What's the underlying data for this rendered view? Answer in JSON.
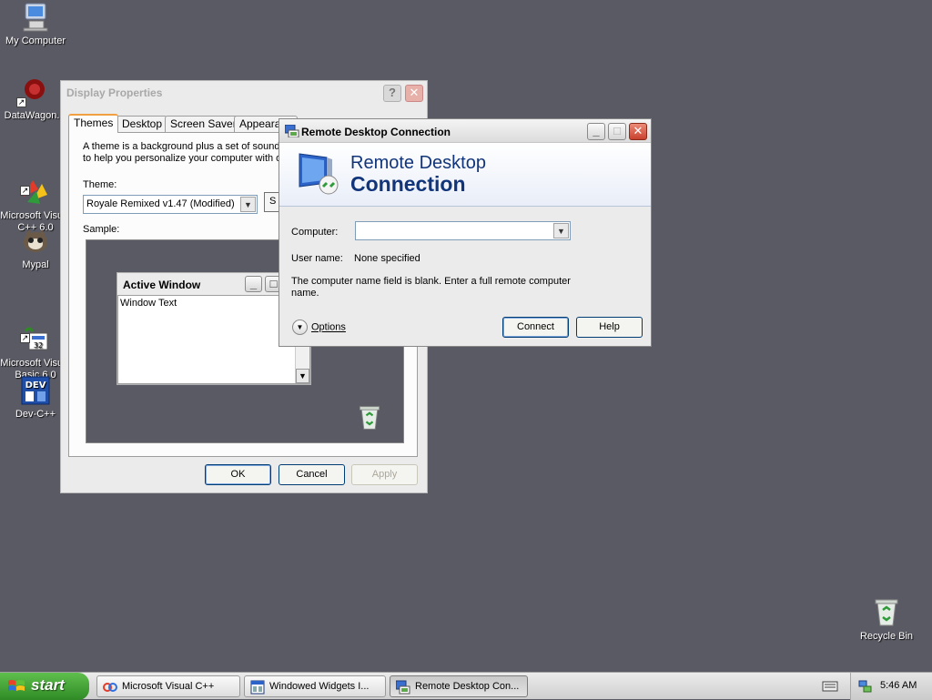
{
  "desktop": {
    "icons": [
      {
        "label": "My Computer",
        "icon": "my-computer-icon"
      },
      {
        "label": "DataWagon.",
        "icon": "datawagon-icon"
      },
      {
        "label": "Microsoft Visual\nC++ 6.0",
        "icon": "visual-cpp-icon"
      },
      {
        "label": "Mypal",
        "icon": "mypal-icon"
      },
      {
        "label": "Microsoft Visual\nBasic 6.0",
        "icon": "visual-basic-icon"
      },
      {
        "label": "Dev-C++",
        "icon": "dev-cpp-icon"
      },
      {
        "label": "Recycle Bin",
        "icon": "recycle-bin-icon"
      }
    ],
    "background_color": "#5a5a64"
  },
  "display_properties": {
    "title": "Display Properties",
    "tabs": [
      "Themes",
      "Desktop",
      "Screen Saver",
      "Appearance"
    ],
    "active_tab": "Themes",
    "description": "A theme is a background plus a set of sounds,\nto help you personalize your computer with one",
    "theme_label": "Theme:",
    "theme_value": "Royale Remixed v1.47 (Modified)",
    "save_button_partial": "S",
    "sample_label": "Sample:",
    "sample_window_title": "Active Window",
    "sample_window_text": "Window Text",
    "buttons": {
      "ok": "OK",
      "cancel": "Cancel",
      "apply": "Apply"
    }
  },
  "remote_desktop": {
    "title": "Remote Desktop Connection",
    "banner_line1": "Remote Desktop",
    "banner_line2": "Connection",
    "computer_label": "Computer:",
    "computer_value": "",
    "username_label": "User name:",
    "username_value": "None specified",
    "note": "The computer name field is blank. Enter a full remote computer name.",
    "options_label": "Options",
    "connect_label": "Connect",
    "help_label": "Help"
  },
  "taskbar": {
    "start_label": "start",
    "tasks": [
      {
        "label": "Microsoft Visual C++",
        "icon": "visual-cpp-icon",
        "active": false
      },
      {
        "label": "Windowed Widgets I...",
        "icon": "window-icon",
        "active": false
      },
      {
        "label": "Remote Desktop Con...",
        "icon": "rdc-icon",
        "active": true
      }
    ],
    "clock": "5:46 AM"
  },
  "colors": {
    "accent": "#11357a",
    "start_green": "#3a9a2e",
    "close_red": "#c8422e"
  }
}
